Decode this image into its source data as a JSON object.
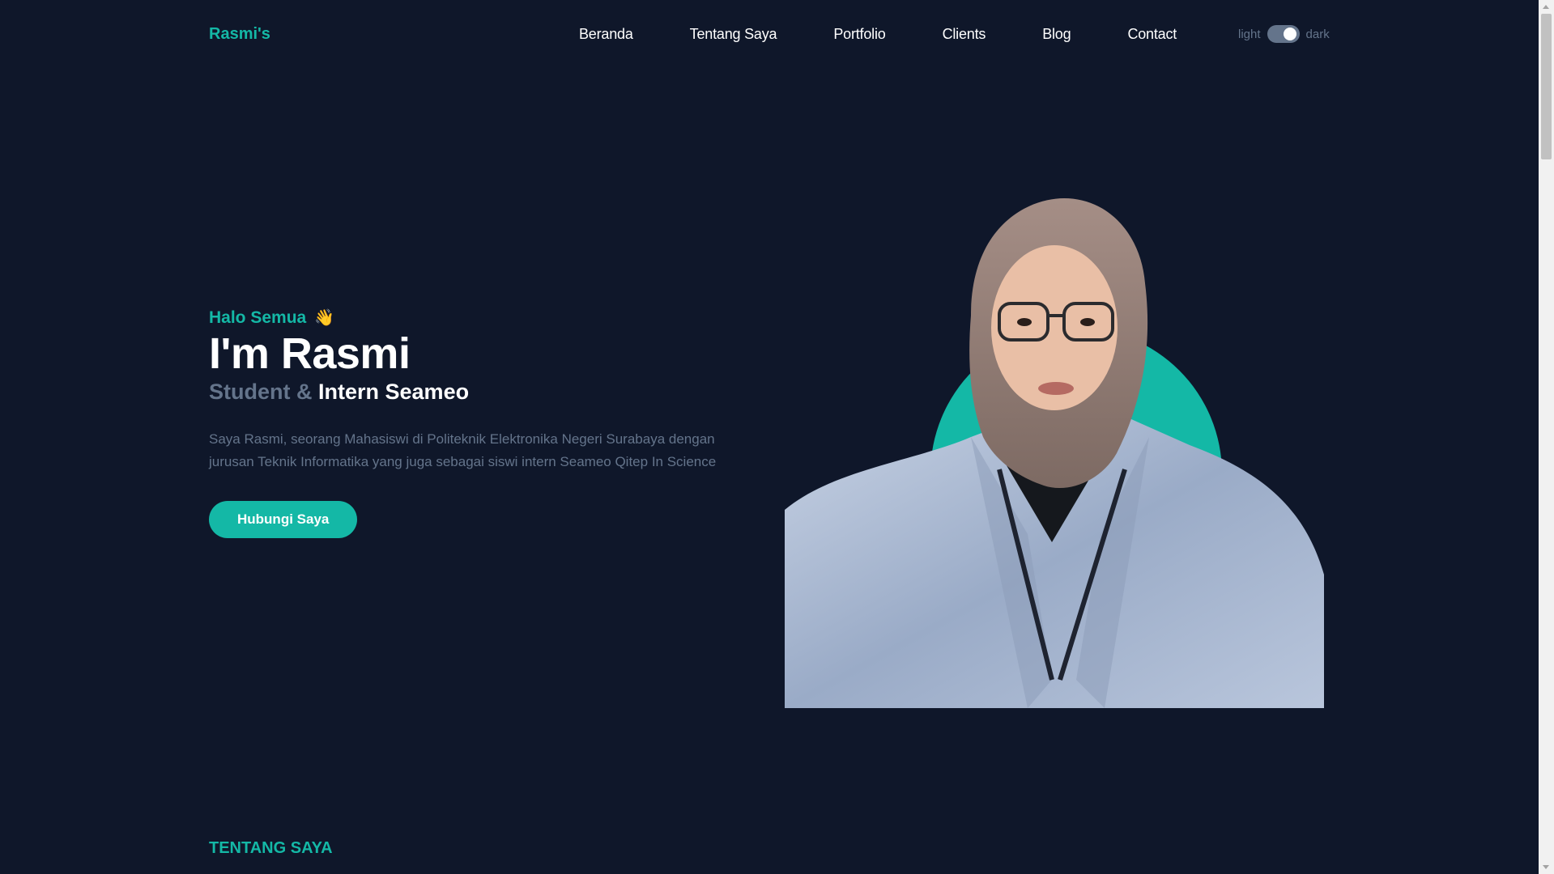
{
  "brand": "Rasmi's",
  "nav": {
    "items": [
      "Beranda",
      "Tentang Saya",
      "Portfolio",
      "Clients",
      "Blog",
      "Contact"
    ]
  },
  "theme": {
    "light_label": "light",
    "dark_label": "dark",
    "mode": "dark"
  },
  "hero": {
    "greeting": "Halo Semua",
    "wave": "👋",
    "name": "I'm Rasmi",
    "role_prefix": "Student &",
    "role_main": "Intern Seameo",
    "description": "Saya Rasmi, seorang Mahasiswi di Politeknik Elektronika Negeri Surabaya dengan jurusan Teknik Informatika yang juga sebagai siswi intern Seameo Qitep In Science",
    "cta_label": "Hubungi Saya"
  },
  "section": {
    "about_title": "TENTANG SAYA"
  },
  "colors": {
    "accent": "#14b8a6",
    "background": "#0f172a",
    "muted": "#64748b"
  }
}
